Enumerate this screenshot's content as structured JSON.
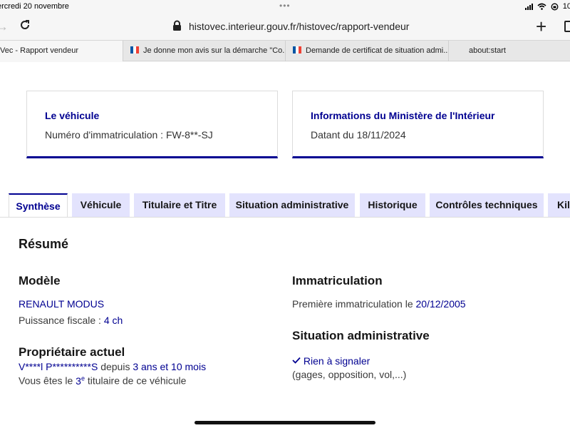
{
  "status_bar": {
    "date": "ercredi 20 novembre",
    "more": "•••",
    "battery": "10"
  },
  "browser": {
    "url": "histovec.interieur.gouv.fr/histovec/rapport-vendeur",
    "tabs": [
      {
        "label": "Vec - Rapport vendeur"
      },
      {
        "label": "Je donne mon avis sur la démarche \"Co..."
      },
      {
        "label": "Demande de certificat de situation admi..."
      },
      {
        "label": "about:start"
      }
    ]
  },
  "cards": {
    "vehicle": {
      "title": "Le véhicule",
      "value": "Numéro d'immatriculation : FW-8**-SJ"
    },
    "ministry": {
      "title": "Informations du Ministère de l'Intérieur",
      "value": "Datant du 18/11/2024"
    }
  },
  "page_tabs": [
    "Synthèse",
    "Véhicule",
    "Titulaire et Titre",
    "Situation administrative",
    "Historique",
    "Contrôles techniques",
    "Kilo"
  ],
  "summary": {
    "heading": "Résumé",
    "model": {
      "heading": "Modèle",
      "name": "RENAULT MODUS",
      "power_label": "Puissance fiscale :",
      "power_value": "4 ch"
    },
    "owner": {
      "heading": "Propriétaire actuel",
      "name": "V****l P**********S",
      "since_label": "depuis",
      "since_value": "3 ans et 10 mois",
      "rank_prefix": "Vous êtes le",
      "rank_value": "3",
      "rank_sup": "e",
      "rank_suffix": "titulaire de ce véhicule"
    },
    "registration": {
      "heading": "Immatriculation",
      "label": "Première immatriculation le",
      "date": "20/12/2005"
    },
    "admin": {
      "heading": "Situation administrative",
      "status": "Rien à signaler",
      "note": "(gages, opposition, vol,...)"
    }
  }
}
